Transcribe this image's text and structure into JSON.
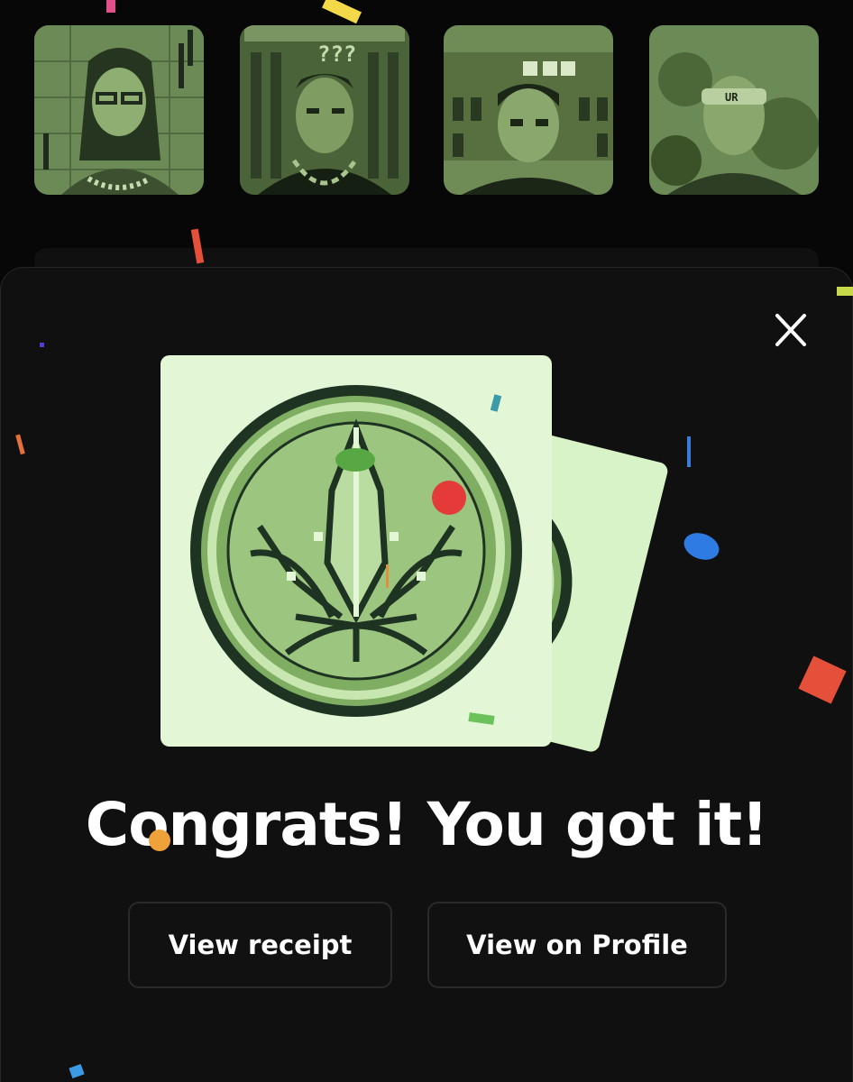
{
  "modal": {
    "headline": "Congrats! You got it!",
    "close_icon": "close-icon",
    "buttons": {
      "view_receipt": "View receipt",
      "view_on_profile": "View on Profile"
    }
  },
  "collection": {
    "thumbnails": [
      {
        "name": "nft-thumbnail-1",
        "icon": "pixel-portrait-glasses"
      },
      {
        "name": "nft-thumbnail-2",
        "icon": "pixel-portrait-chain"
      },
      {
        "name": "nft-thumbnail-3",
        "icon": "pixel-portrait-skulls"
      },
      {
        "name": "nft-thumbnail-4",
        "icon": "pixel-portrait-visor"
      }
    ]
  },
  "reward": {
    "front_card_icon": "pixel-leaf-coin",
    "back_card_icon": "pixel-coin"
  },
  "colors": {
    "background": "#070707",
    "modal": "#101010",
    "card": "#e3f7d6",
    "coin_light": "#b9dca0",
    "coin_mid": "#7fae63",
    "coin_dark": "#1e3322",
    "text": "#ffffff"
  }
}
